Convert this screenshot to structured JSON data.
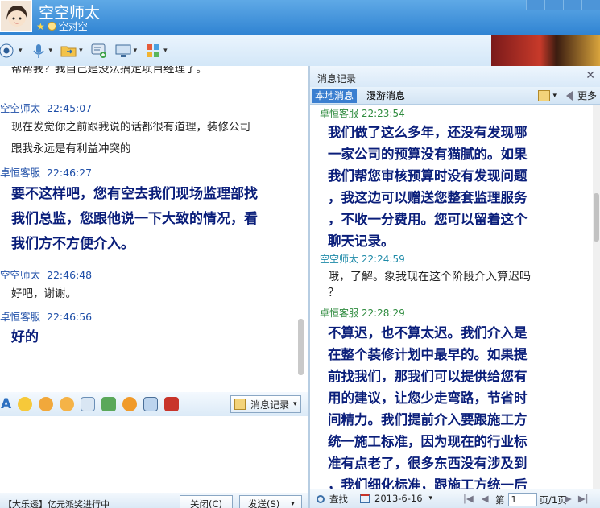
{
  "window": {
    "title": "空空师太",
    "status": "空对空"
  },
  "toolbar": {
    "items": [
      "video-call-icon",
      "voice-call-icon",
      "send-file-icon",
      "create-group-icon",
      "remote-assist-icon",
      "apps-icon"
    ]
  },
  "chat": {
    "partial_top": "帮帮我？我自己是没法搞定项目经理了。",
    "messages": [
      {
        "sender": "空空师太",
        "time": "22:45:07",
        "text_lines": [
          "现在发觉你之前跟我说的话都很有道理，装修公司",
          "跟我永远是有利益冲突的"
        ]
      },
      {
        "sender": "卓恒客服",
        "time": "22:46:27",
        "text_lines": [
          "要不这样吧，您有空去我们现场监理部找",
          "我们总监，您跟他说一下大致的情况，看",
          "我们方不方便介入。"
        ]
      },
      {
        "sender": "空空师太",
        "time": "22:46:48",
        "text_lines": [
          "好吧，谢谢。"
        ]
      },
      {
        "sender": "卓恒客服",
        "time": "22:46:56",
        "text_lines": [
          "好的"
        ]
      }
    ],
    "history_button": "消息记录",
    "bottom_text": "【大乐透】亿元派奖进行中",
    "close_button": "关闭(C)",
    "send_button": "发送(S)"
  },
  "history": {
    "title": "消息记录",
    "tabs": [
      "本地消息",
      "漫游消息"
    ],
    "more": "更多",
    "messages": [
      {
        "sender": "卓恒客服",
        "time": "22:23:54",
        "text_lines": [
          "我们做了这么多年，还没有发现哪",
          "一家公司的预算没有猫腻的。如果",
          "我们帮您审核预算时没有发现问题",
          "，我这边可以赠送您整套监理服务",
          "，不收一分费用。您可以留着这个",
          "聊天记录。"
        ]
      },
      {
        "sender": "空空师太",
        "time": "22:24:59",
        "text_lines": [
          "哦，了解。象我现在这个阶段介入算迟吗",
          "？"
        ]
      },
      {
        "sender": "卓恒客服",
        "time": "22:28:29",
        "text_lines": [
          "不算迟，也不算太迟。我们介入是",
          "在整个装修计划中最早的。如果提",
          "前找我们，那我们可以提供给您有",
          "用的建议，让您少走弯路，节省时",
          "间精力。我们提前介入要跟施工方",
          "统一施工标准，因为现在的行业标",
          "准有点老了，很多东西没有涉及到",
          "，我们细化标准，跟施工方统一后"
        ]
      }
    ],
    "footer": {
      "search": "查找",
      "date": "2013-6-16",
      "page_prefix": "第",
      "page_value": "1",
      "page_suffix": "页/1页"
    }
  }
}
